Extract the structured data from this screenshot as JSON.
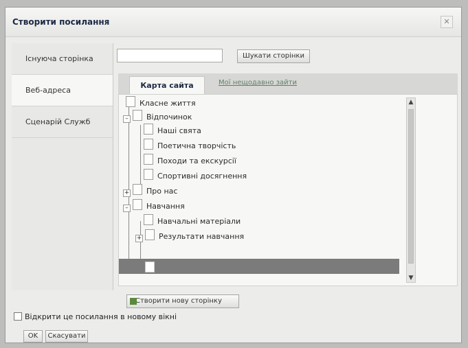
{
  "dialog": {
    "title": "Створити посилання"
  },
  "sidebar": {
    "items": [
      {
        "label": "Існуюча сторінка"
      },
      {
        "label": "Веб-адреса"
      },
      {
        "label": "Сценарій Служб"
      }
    ]
  },
  "search": {
    "placeholder": "",
    "button_label": "Шукати сторінки"
  },
  "tabs": {
    "active": "Карта сайта",
    "link": "Мої нещодавно зайти"
  },
  "tree": {
    "nodes": [
      "Класне життя",
      "Відпочинок",
      "Наші свята",
      "Поетична творчість",
      "Походи та екскурсії",
      "Спортивні досягнення",
      "Про нас",
      "Навчання",
      "Навчальні матеріали",
      "Результати навчання"
    ],
    "selected_label": ""
  },
  "buttons": {
    "new_page": "Створити нову сторінку",
    "ok": "OK",
    "cancel": "Скасувати"
  },
  "checkbox": {
    "label": "Відкрити це посилання в новому вікні"
  }
}
